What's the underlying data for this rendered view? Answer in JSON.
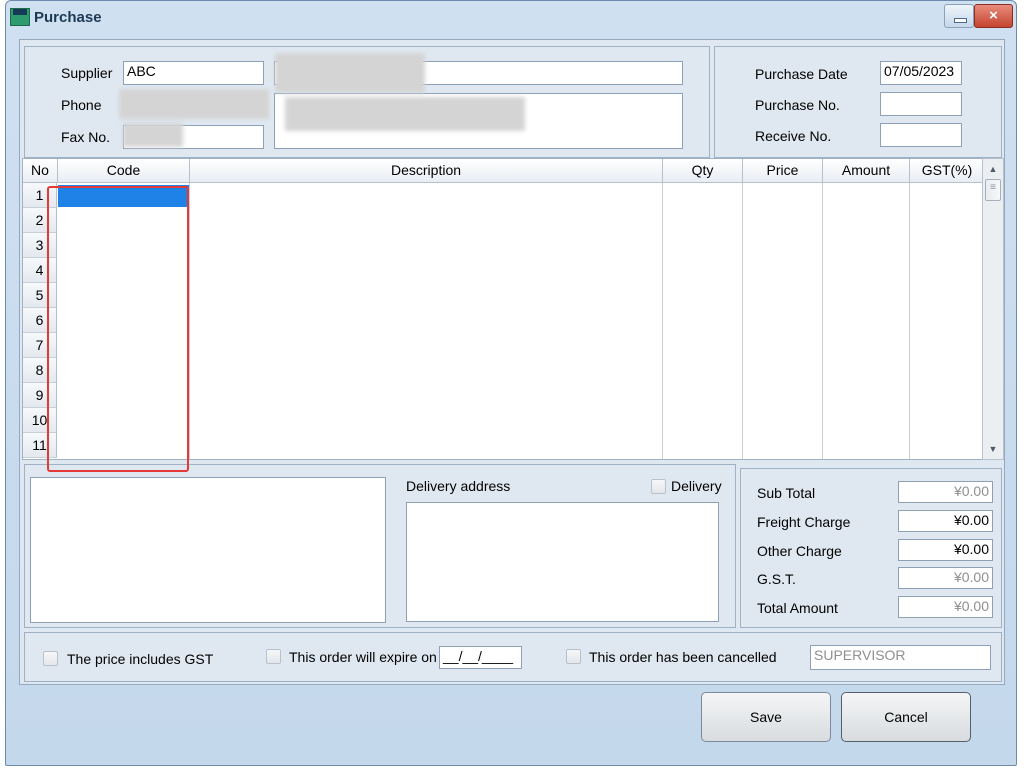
{
  "window": {
    "title": "Purchase",
    "close_glyph": "×",
    "icon": "app-icon"
  },
  "supplier": {
    "supplier_label": "Supplier",
    "supplier_value": "ABC",
    "phone_label": "Phone",
    "fax_label": "Fax No."
  },
  "purchase": {
    "date_label": "Purchase Date",
    "date_value": "07/05/2023",
    "no_label": "Purchase No.",
    "receive_label": "Receive No."
  },
  "grid": {
    "columns": [
      "No",
      "Code",
      "Description",
      "Qty",
      "Price",
      "Amount",
      "GST(%)"
    ],
    "rows": [
      "1",
      "2",
      "3",
      "4",
      "5",
      "6",
      "7",
      "8",
      "9",
      "10",
      "11"
    ]
  },
  "delivery": {
    "address_label": "Delivery address",
    "checkbox_label": "Delivery"
  },
  "totals": {
    "sub_total_label": "Sub Total",
    "sub_total": "¥0.00",
    "freight_label": "Freight Charge",
    "freight": "¥0.00",
    "other_label": "Other Charge",
    "other": "¥0.00",
    "gst_label": "G.S.T.",
    "gst": "¥0.00",
    "total_label": "Total Amount",
    "total": "¥0.00"
  },
  "options": {
    "includes_gst": "The price includes GST",
    "expire": "This order will expire on",
    "expire_date": "__/__/____",
    "cancelled": "This order has been cancelled",
    "user": "SUPERVISOR"
  },
  "buttons": {
    "save": "Save",
    "cancel": "Cancel"
  }
}
